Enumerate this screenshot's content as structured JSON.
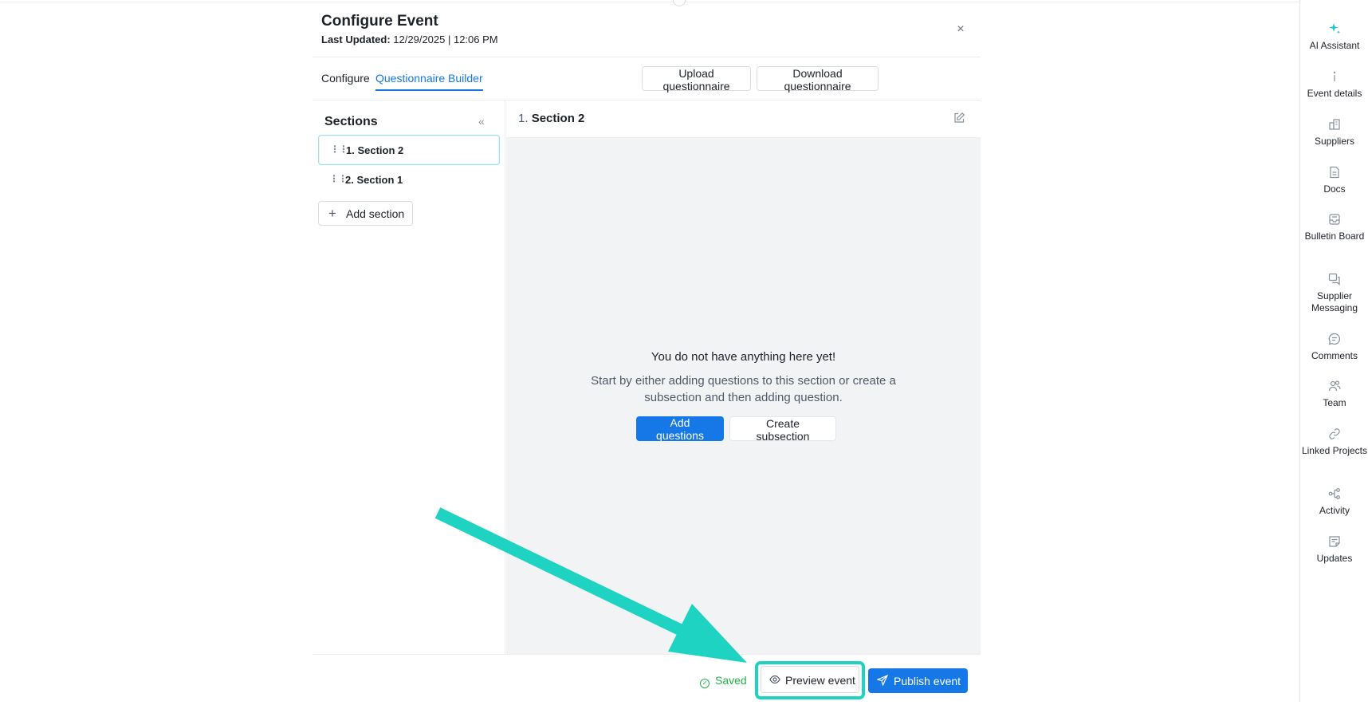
{
  "header": {
    "title": "Configure Event",
    "updated_label": "Last Updated:",
    "updated_value": "12/29/2025 | 12:06 PM",
    "close_glyph": "×"
  },
  "tabs": [
    {
      "label": "Configure",
      "active": false
    },
    {
      "label": "Questionnaire Builder",
      "active": true
    }
  ],
  "toolbar": {
    "upload_label": "Upload questionnaire",
    "download_label": "Download questionnaire"
  },
  "sections_panel": {
    "title": "Sections",
    "collapse_glyph": "«",
    "items": [
      {
        "label": "1. Section 2",
        "active": true
      },
      {
        "label": "2. Section 1",
        "active": false
      }
    ],
    "add_label": "Add section"
  },
  "content": {
    "section_number": "1.",
    "section_name": "Section 2",
    "empty_title": "You do not have anything here yet!",
    "empty_desc": "Start by either adding questions to this section or create a subsection and then adding question.",
    "add_questions_label": "Add questions",
    "create_subsection_label": "Create subsection"
  },
  "footer": {
    "saved_label": "Saved",
    "preview_label": "Preview event",
    "publish_label": "Publish event"
  },
  "rail": [
    {
      "label": "AI Assistant",
      "icon": "sparkle-icon"
    },
    {
      "label": "Event details",
      "icon": "info-icon"
    },
    {
      "label": "Suppliers",
      "icon": "building-icon"
    },
    {
      "label": "Docs",
      "icon": "document-icon"
    },
    {
      "label": "Bulletin Board",
      "icon": "inbox-icon"
    },
    {
      "label": "Supplier Messaging",
      "icon": "messages-icon"
    },
    {
      "label": "Comments",
      "icon": "comment-icon"
    },
    {
      "label": "Team",
      "icon": "team-icon"
    },
    {
      "label": "Linked Projects",
      "icon": "link-icon"
    },
    {
      "label": "Activity",
      "icon": "activity-icon"
    },
    {
      "label": "Updates",
      "icon": "updates-icon"
    }
  ],
  "colors": {
    "accent": "#1677e6",
    "saved": "#22b04b",
    "annotation": "#1ed3c1",
    "ai_icon": "#1ec3d6"
  }
}
